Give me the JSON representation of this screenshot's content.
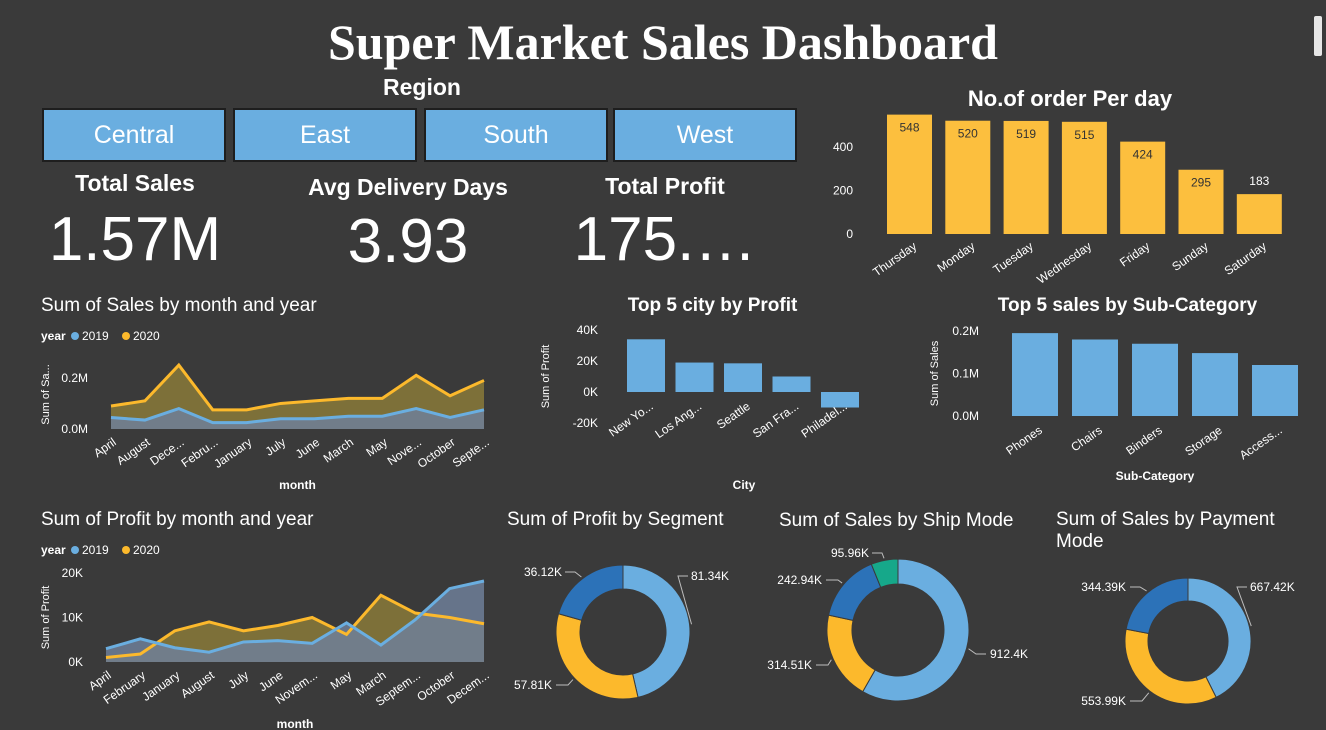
{
  "title": "Super Market Sales Dashboard",
  "region_slicer": {
    "label": "Region",
    "options": [
      "Central",
      "East",
      "South",
      "West"
    ]
  },
  "kpis": {
    "total_sales": {
      "label": "Total Sales",
      "value": "1.57M"
    },
    "avg_delivery": {
      "label": "Avg Delivery Days",
      "value": "3.93"
    },
    "total_profit": {
      "label": "Total Profit",
      "value": "175.…"
    }
  },
  "colors": {
    "bg": "#3a3a3a",
    "blue": "#6aaee0",
    "gold": "#fcbf3e",
    "series2019": "#6aaee0",
    "series2020": "#fcb92c",
    "dark_blue": "#2c72b8",
    "teal": "#16a88a"
  },
  "chart_data": [
    {
      "id": "orders_per_day",
      "type": "bar",
      "title": "No.of order Per day",
      "categories": [
        "Thursday",
        "Monday",
        "Tuesday",
        "Wednesday",
        "Friday",
        "Sunday",
        "Saturday"
      ],
      "values": [
        548,
        520,
        519,
        515,
        424,
        295,
        183
      ],
      "yticks": [
        "400",
        "200",
        "0"
      ],
      "ylim": [
        0,
        560
      ]
    },
    {
      "id": "sales_by_month",
      "type": "area",
      "title": "Sum of Sales by month and year",
      "legend_title": "year",
      "xlabel": "month",
      "ylabel": "Sum of Sa...",
      "categories": [
        "April",
        "August",
        "Dece...",
        "Febru...",
        "January",
        "July",
        "June",
        "March",
        "May",
        "Nove...",
        "October",
        "Septe..."
      ],
      "yticks": [
        "0.2M",
        "0.0M"
      ],
      "ylim": [
        0,
        0.27
      ],
      "series": [
        {
          "name": "2019",
          "values": [
            0.045,
            0.035,
            0.08,
            0.025,
            0.025,
            0.04,
            0.04,
            0.05,
            0.05,
            0.08,
            0.045,
            0.075
          ]
        },
        {
          "name": "2020",
          "values": [
            0.09,
            0.11,
            0.25,
            0.075,
            0.075,
            0.1,
            0.11,
            0.12,
            0.12,
            0.21,
            0.13,
            0.19
          ]
        }
      ]
    },
    {
      "id": "top5_city_profit",
      "type": "bar",
      "title": "Top 5 city by Profit",
      "xlabel": "City",
      "ylabel": "Sum of Profit",
      "categories": [
        "New Yo...",
        "Los Ang...",
        "Seattle",
        "San Fra...",
        "Philadel..."
      ],
      "values": [
        34000,
        19000,
        18500,
        10000,
        -10000
      ],
      "yticks": [
        "40K",
        "20K",
        "0K",
        "-20K"
      ],
      "ylim": [
        -20000,
        40000
      ]
    },
    {
      "id": "top5_subcategory_sales",
      "type": "bar",
      "title": "Top 5 sales by Sub-Category",
      "xlabel": "Sub-Category",
      "ylabel": "Sum of Sales",
      "categories": [
        "Phones",
        "Chairs",
        "Binders",
        "Storage",
        "Access..."
      ],
      "values": [
        0.195,
        0.18,
        0.17,
        0.148,
        0.12
      ],
      "yticks": [
        "0.2M",
        "0.1M",
        "0.0M"
      ],
      "ylim": [
        0,
        0.2
      ]
    },
    {
      "id": "profit_by_month",
      "type": "area",
      "title": "Sum of Profit by month and year",
      "legend_title": "year",
      "xlabel": "month",
      "ylabel": "Sum of Profit",
      "categories": [
        "April",
        "February",
        "January",
        "August",
        "July",
        "June",
        "Novem...",
        "May",
        "March",
        "Septem...",
        "October",
        "Decem..."
      ],
      "yticks": [
        "20K",
        "10K",
        "0K"
      ],
      "ylim": [
        0,
        20000
      ],
      "series": [
        {
          "name": "2019",
          "values": [
            3000,
            5200,
            3200,
            2200,
            4500,
            4800,
            4200,
            8800,
            3800,
            9500,
            16500,
            18200
          ]
        },
        {
          "name": "2020",
          "values": [
            1000,
            1800,
            7000,
            9000,
            7000,
            8200,
            10000,
            6200,
            15000,
            11000,
            10000,
            8600
          ]
        }
      ]
    },
    {
      "id": "profit_by_segment",
      "type": "pie",
      "title": "Sum of Profit by Segment",
      "labels": [
        "81.34K",
        "57.81K",
        "36.12K"
      ],
      "values": [
        81.34,
        57.81,
        36.12
      ]
    },
    {
      "id": "sales_by_ship_mode",
      "type": "pie",
      "title": "Sum of Sales by Ship Mode",
      "labels": [
        "912.4K",
        "314.51K",
        "242.94K",
        "95.96K"
      ],
      "values": [
        912.4,
        314.51,
        242.94,
        95.96
      ]
    },
    {
      "id": "sales_by_payment_mode",
      "type": "pie",
      "title": "Sum of Sales by Payment Mode",
      "labels": [
        "667.42K",
        "553.99K",
        "344.39K"
      ],
      "values": [
        667.42,
        553.99,
        344.39
      ]
    }
  ]
}
